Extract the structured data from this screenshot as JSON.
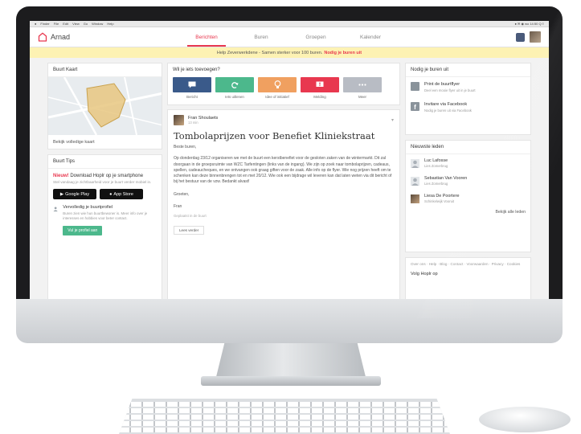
{
  "menubar": {
    "items": [
      "Finder",
      "File",
      "Edit",
      "View",
      "Go",
      "Window",
      "Help"
    ],
    "right": "● ✉ ◉ wo 14:50  Q ≡"
  },
  "brand": {
    "name": "Arnad",
    "accent": "#e8384f"
  },
  "nav": {
    "tabs": [
      "Berichten",
      "Buren",
      "Groepen",
      "Kalender"
    ],
    "active_tab": "Berichten"
  },
  "banner": {
    "text": "Help Zeverwerkdene - Samen sterker voor 100 buren.",
    "link": "Nodig je buren uit"
  },
  "left": {
    "map_title": "Buurt Kaart",
    "map_link": "Bekijk volledige kaart",
    "tips_title": "Buurt Tips",
    "tip_highlight": "Nieuw!",
    "tip_title": " Download Hoplr op je smartphone",
    "tip_sub": "Stel vandaag je zichtbaarheid voor je buurt verder mobiel in.",
    "stores": [
      "Google Play",
      "App Store"
    ],
    "profile_title": "Vervolledig je buurtprofiel",
    "profile_sub": "Buren zien wie hun buurtbewoner is. Meer info over je interesses en hobbies voor beter contact.",
    "profile_button": "Vul je profiel aan"
  },
  "middle": {
    "prompt": "Wil je iets toevoegen?",
    "actions": [
      {
        "label": "Bericht",
        "color": "#3a5a8a",
        "icon": "speech-bubble-icon"
      },
      {
        "label": "Iets uitlenen",
        "color": "#4cb88c",
        "icon": "recycle-icon"
      },
      {
        "label": "Idee of initiatief",
        "color": "#f0a060",
        "icon": "lightbulb-icon"
      },
      {
        "label": "Melding",
        "color": "#e8384f",
        "icon": "alert-icon"
      },
      {
        "label": "Meer",
        "color": "#b8bcc4",
        "icon": "more-icon"
      }
    ],
    "post": {
      "author": "Fran Shoulaets",
      "time": "13 min",
      "title": "Tombolaprijzen voor Benefiet Kliniekstraat",
      "greeting": "Beste buren,",
      "body": "Op donderdag 23/12 organiseren we met de buurt een kerstbenefiet voor de gesloten zaken van de wintermarkt. Dit zal doorgaan in de groepsruimte van WZC Tarfentingen (links van de ingang). We zijn op zoek naar tombolaprijzen, cadeaus, spellen, cadeaucheques, en we ontvangen ook graag giften voor de zaak. Alle info op de flyer. Wie nog prijzen heeft om te schenken kan deze binnenbrengen tot en met 20/12. Wie ook een bijdrage wil leveren kan dat laten weten via dit bericht of bij het bestuur van de vzw. Bedankt alvast!",
      "closing": "Groeten,",
      "signature": "Fran",
      "meta": "Geplaatst in de buurt",
      "button": "Lees verder"
    }
  },
  "right": {
    "invite_title": "Nodig je buren uit",
    "invites": [
      {
        "title": "Print de buurtflyer",
        "sub": "Deel een mooie flyer uit in je buurt",
        "color": "#8a939b",
        "icon": "document-icon"
      },
      {
        "title": "Invitare via Facebook",
        "sub": "Nodig je buren uit via Facebook",
        "color": "#8a939b",
        "icon": "facebook-icon"
      }
    ],
    "members_title": "Nieuwste leden",
    "members": [
      {
        "name": "Luc Lafosse",
        "sub": "Lies Zomerbrug"
      },
      {
        "name": "Sebastian Van Vooren",
        "sub": "Lies Zomerbrug"
      },
      {
        "name": "Liesa De Poortere",
        "sub": "Schinkelwijk Vooruit"
      }
    ],
    "all_members": "Bekijk alle leden",
    "footer": "Over ons · Help · Blog · Contact · Voorwaarden · Privacy · Cookies",
    "follow": "Volg Hoplr op"
  }
}
